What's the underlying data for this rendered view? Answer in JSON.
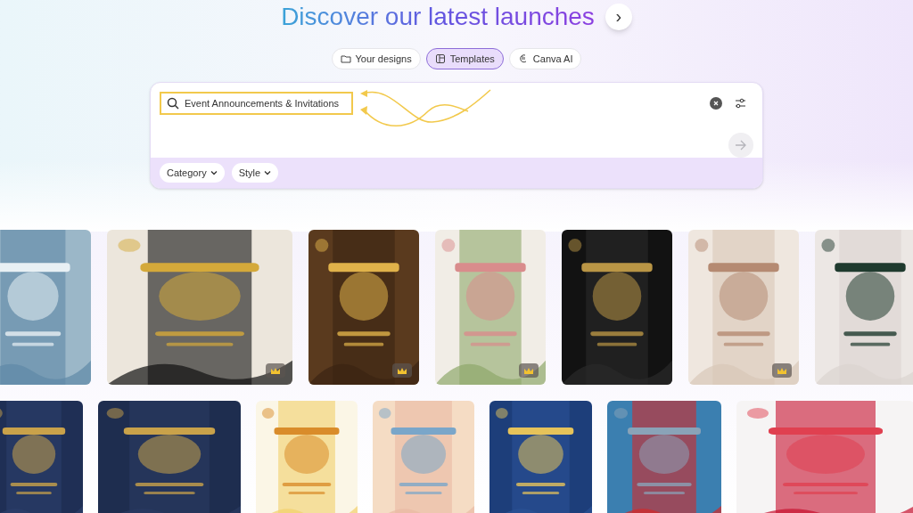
{
  "heading": {
    "title": "Discover our latest launches",
    "next": "›"
  },
  "tabs": [
    {
      "label": "Your designs",
      "selected": false
    },
    {
      "label": "Templates",
      "selected": true
    },
    {
      "label": "Canva AI",
      "selected": false
    }
  ],
  "search": {
    "value": "Event Announcements & Invitations",
    "highlighted": true
  },
  "filters": [
    {
      "label": "Category"
    },
    {
      "label": "Style"
    }
  ],
  "template_rows": [
    [
      {
        "kind": "picture",
        "premium": false
      },
      {
        "kind": "picture",
        "premium": true
      },
      {
        "kind": "picture",
        "premium": true
      },
      {
        "kind": "picture",
        "premium": true
      },
      {
        "kind": "picture",
        "premium": false
      },
      {
        "kind": "picture",
        "premium": true
      },
      {
        "kind": "picture",
        "premium": false
      }
    ],
    [
      {
        "kind": "picture",
        "premium": false
      },
      {
        "kind": "picture",
        "premium": false
      },
      {
        "kind": "picture",
        "premium": false
      },
      {
        "kind": "picture",
        "premium": false
      },
      {
        "kind": "picture",
        "premium": false
      },
      {
        "kind": "picture",
        "premium": false
      },
      {
        "kind": "picture",
        "premium": false
      }
    ]
  ]
}
